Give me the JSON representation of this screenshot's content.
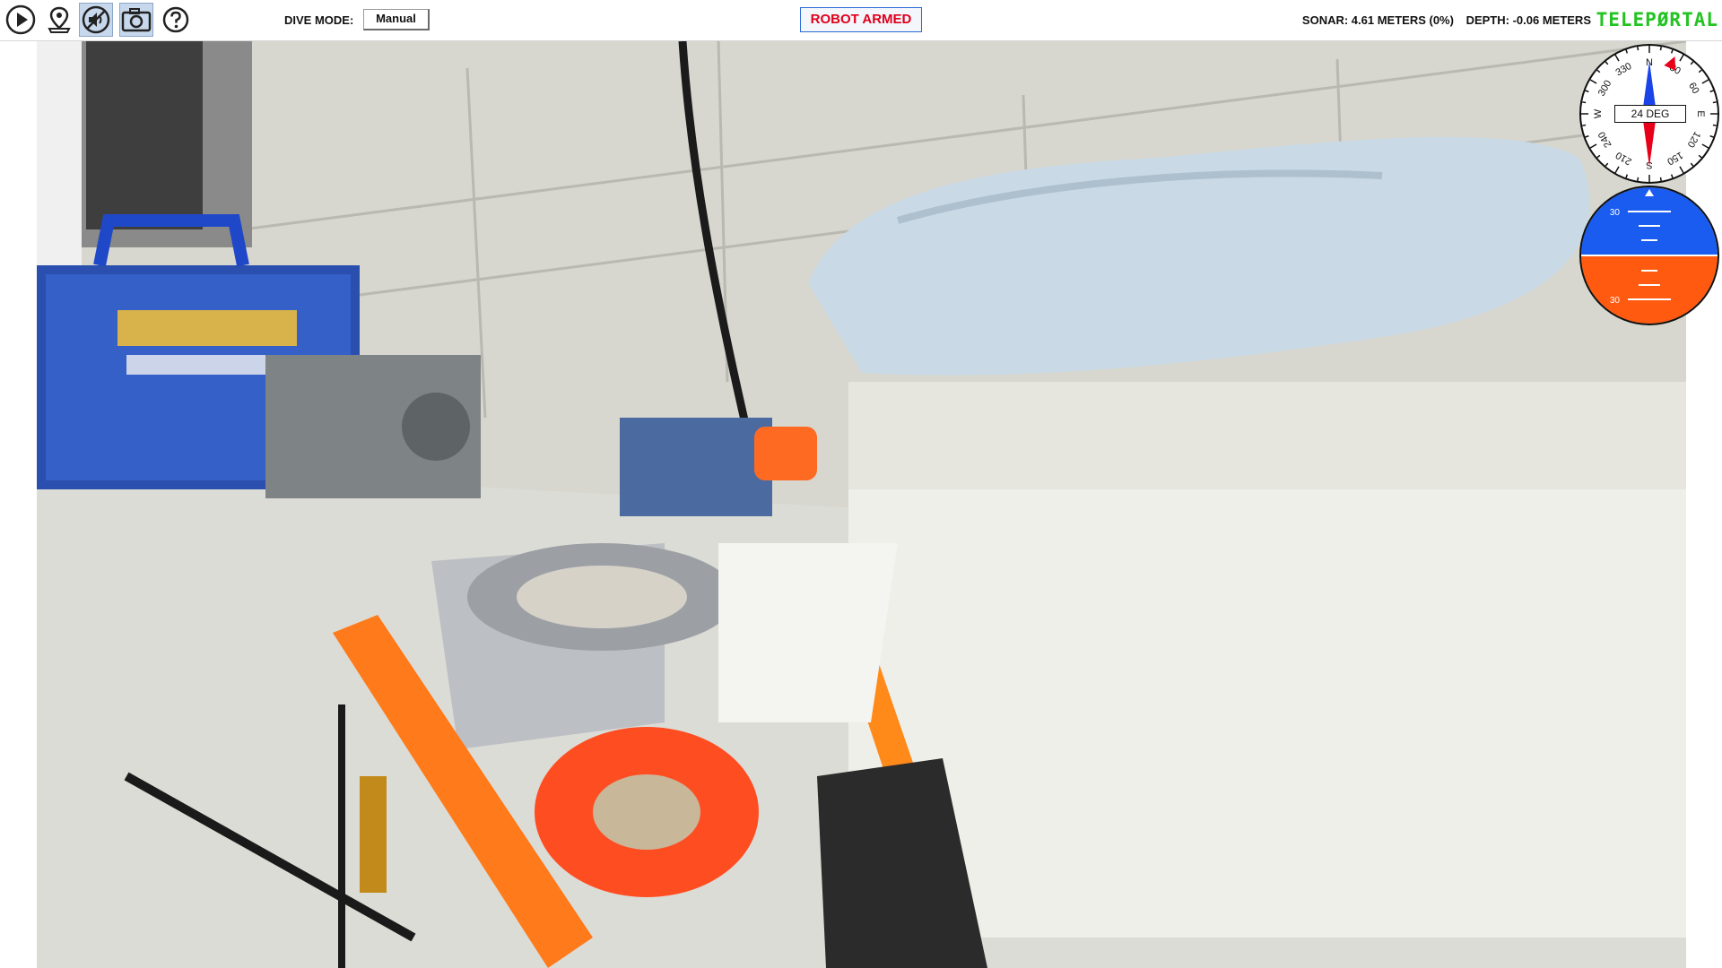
{
  "toolbar": {
    "buttons": [
      {
        "name": "play-icon",
        "active": false
      },
      {
        "name": "location-pin-icon",
        "active": false
      },
      {
        "name": "speaker-icon",
        "active": true
      },
      {
        "name": "camera-icon",
        "active": true
      },
      {
        "name": "help-icon",
        "active": false
      }
    ],
    "dive_mode_label": "DIVE MODE:",
    "dive_mode_value": "Manual",
    "armed_status": "ROBOT ARMED",
    "sonar": "SONAR: 4.61 METERS (0%)",
    "depth": "DEPTH: -0.06 METERS",
    "brand": "TELEPØRTAL"
  },
  "compass": {
    "heading_text": "24 DEG",
    "heading_deg": 24,
    "cardinals": [
      "N",
      "E",
      "S",
      "W"
    ],
    "degree_labels": [
      "30",
      "60",
      "120",
      "150",
      "210",
      "240",
      "300",
      "330"
    ]
  },
  "attitude": {
    "pitch_labels": [
      "30",
      "30"
    ],
    "sky_color": "#1a5cf0",
    "ground_color": "#ff5a10"
  },
  "colors": {
    "armed_text": "#e0001b",
    "brand": "#22c322",
    "compass_north": "#1a44e8",
    "compass_south": "#e8001a"
  }
}
